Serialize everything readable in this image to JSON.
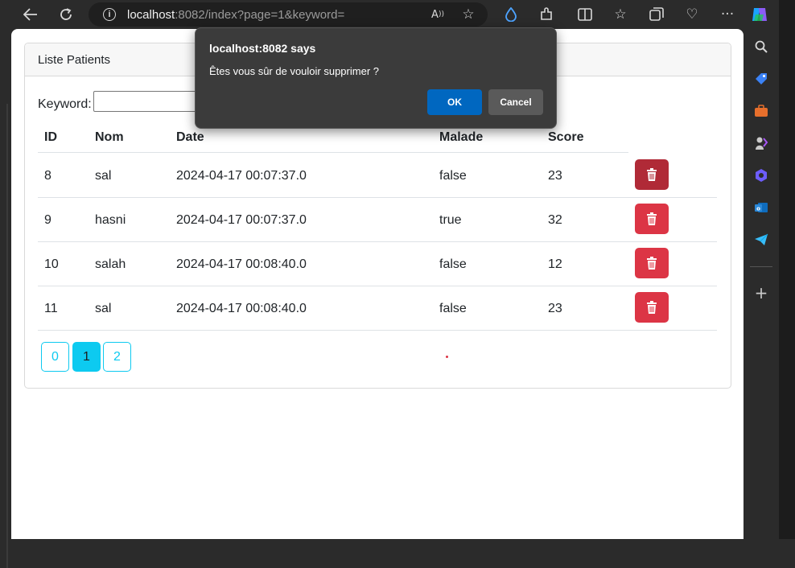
{
  "browser": {
    "url_host": "localhost",
    "url_rest": ":8082/index?page=1&keyword=",
    "icons": [
      "back-arrow-icon",
      "refresh-icon",
      "info-icon",
      "read-aloud-icon",
      "favorite-star-icon",
      "drop-icon",
      "extensions-icon",
      "split-screen-icon",
      "favorites-icon",
      "collections-icon",
      "browser-essentials-icon",
      "more-icon",
      "copilot-icon"
    ]
  },
  "sidebar": {
    "icons": [
      "search-icon",
      "shopping-tag-icon",
      "toolbox-icon",
      "games-icon",
      "copilot-app-icon",
      "outlook-icon",
      "telegram-icon",
      "add-icon"
    ]
  },
  "page": {
    "card_title": "Liste Patients",
    "keyword_label": "Keyword:",
    "keyword_value": "",
    "columns": [
      "ID",
      "Nom",
      "Date",
      "Malade",
      "Score"
    ],
    "rows": [
      {
        "id": "8",
        "nom": "sal",
        "date": "2024-04-17 00:07:37.0",
        "malade": "false",
        "score": "23"
      },
      {
        "id": "9",
        "nom": "hasni",
        "date": "2024-04-17 00:07:37.0",
        "malade": "true",
        "score": "32"
      },
      {
        "id": "10",
        "nom": "salah",
        "date": "2024-04-17 00:08:40.0",
        "malade": "false",
        "score": "12"
      },
      {
        "id": "11",
        "nom": "sal",
        "date": "2024-04-17 00:08:40.0",
        "malade": "false",
        "score": "23"
      }
    ],
    "pages": [
      "0",
      "1",
      "2"
    ],
    "current_page": "1",
    "colors": {
      "danger": "#dc3545",
      "info": "#0dcaf0"
    }
  },
  "dialog": {
    "title": "localhost:8082 says",
    "message": "Êtes vous sûr de vouloir supprimer ?",
    "ok_label": "OK",
    "cancel_label": "Cancel"
  }
}
